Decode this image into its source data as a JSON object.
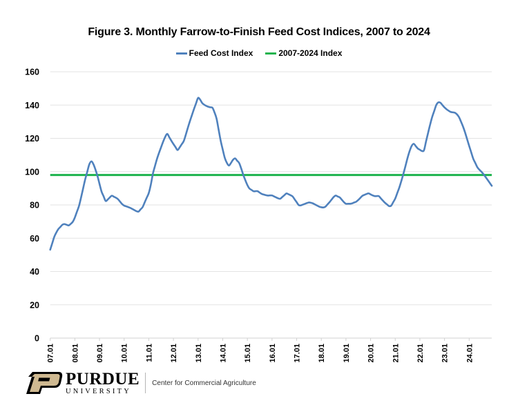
{
  "colors": {
    "feed_cost_line": "#4f81bd",
    "average_line": "#1db34d",
    "gridline": "#e3e3e3",
    "axis": "#d0d0d0",
    "purdue_gold": "#cfb991"
  },
  "footer": {
    "brand_top": "PURDUE",
    "brand_bottom": "UNIVERSITY",
    "center_name": "Center for Commercial Agriculture"
  },
  "chart_data": {
    "type": "line",
    "title": "Figure 3.  Monthly Farrow-to-Finish Feed Cost Indices, 2007 to 2024",
    "xlabel": "",
    "ylabel": "",
    "ylim": [
      0,
      160
    ],
    "yticks": [
      0,
      20,
      40,
      60,
      80,
      100,
      120,
      140,
      160
    ],
    "grid": true,
    "legend_position": "top-center",
    "x_start": "2007-01",
    "x_end": "2024-12",
    "x_frequency": "monthly",
    "xtick_labels": [
      "07.01",
      "08.01",
      "09.01",
      "10.01",
      "11.01",
      "12.01",
      "13.01",
      "14.01",
      "15.01",
      "16.01",
      "17.01",
      "18.01",
      "19.01",
      "20.01",
      "21.01",
      "22.01",
      "23.01",
      "24.01"
    ],
    "series": [
      {
        "name": "Feed Cost Index",
        "keypoints_month_index_value": [
          [
            0,
            53.1
          ],
          [
            2,
            60.9
          ],
          [
            3.6,
            65
          ],
          [
            6.4,
            68.7
          ],
          [
            9.2,
            67.6
          ],
          [
            11.4,
            70.4
          ],
          [
            14.2,
            80
          ],
          [
            17,
            95.2
          ],
          [
            19.3,
            105.6
          ],
          [
            20.4,
            106.5
          ],
          [
            22.6,
            99.4
          ],
          [
            24.9,
            88.3
          ],
          [
            27.1,
            82.1
          ],
          [
            29.9,
            85.6
          ],
          [
            32.7,
            83.9
          ],
          [
            35.5,
            79.8
          ],
          [
            38.9,
            78.3
          ],
          [
            42.8,
            75.7
          ],
          [
            45,
            78.7
          ],
          [
            48.4,
            88.3
          ],
          [
            50.1,
            99.4
          ],
          [
            52.3,
            109
          ],
          [
            55.2,
            118.7
          ],
          [
            56.8,
            123.1
          ],
          [
            59.6,
            117.3
          ],
          [
            62.1,
            112.8
          ],
          [
            65.2,
            118.7
          ],
          [
            67.5,
            128.4
          ],
          [
            70.3,
            138.7
          ],
          [
            72.2,
            144.9
          ],
          [
            74.2,
            140.8
          ],
          [
            76.5,
            139.1
          ],
          [
            79.2,
            138.3
          ],
          [
            80.9,
            132.5
          ],
          [
            83.2,
            117.3
          ],
          [
            85.4,
            106.3
          ],
          [
            87.1,
            103.5
          ],
          [
            89.7,
            108.4
          ],
          [
            92.2,
            104.9
          ],
          [
            94.4,
            96.6
          ],
          [
            96.6,
            90.2
          ],
          [
            99.4,
            87.9
          ],
          [
            100.6,
            88.6
          ],
          [
            102.8,
            86.7
          ],
          [
            105.6,
            85.6
          ],
          [
            107.8,
            85.8
          ],
          [
            111.8,
            83.5
          ],
          [
            115.1,
            87
          ],
          [
            117.9,
            85.3
          ],
          [
            121.3,
            79.4
          ],
          [
            125.8,
            81.5
          ],
          [
            127.5,
            81.2
          ],
          [
            131.4,
            78.7
          ],
          [
            133.6,
            78.4
          ],
          [
            135.9,
            81.5
          ],
          [
            138.7,
            85.8
          ],
          [
            141,
            84.5
          ],
          [
            143.7,
            80.7
          ],
          [
            146.5,
            80.7
          ],
          [
            149.3,
            82.1
          ],
          [
            152.1,
            85.6
          ],
          [
            154.9,
            87
          ],
          [
            157.7,
            85.3
          ],
          [
            160,
            85.3
          ],
          [
            162.8,
            81.5
          ],
          [
            165.6,
            78.7
          ],
          [
            167.9,
            83.5
          ],
          [
            170.3,
            91.5
          ],
          [
            172.3,
            100.1
          ],
          [
            174.6,
            111.1
          ],
          [
            176.6,
            117.3
          ],
          [
            179,
            113.9
          ],
          [
            181.8,
            111.8
          ],
          [
            183.5,
            120.8
          ],
          [
            185.7,
            131.8
          ],
          [
            188,
            140.1
          ],
          [
            189.4,
            142.2
          ],
          [
            192.4,
            138
          ],
          [
            194.8,
            135.9
          ],
          [
            197.5,
            135.3
          ],
          [
            199.2,
            132.5
          ],
          [
            201.5,
            125.6
          ],
          [
            203.7,
            116.6
          ],
          [
            206,
            107.7
          ],
          [
            208.2,
            102.1
          ],
          [
            210.4,
            99.4
          ],
          [
            212.1,
            96.6
          ],
          [
            215,
            91.5
          ]
        ]
      },
      {
        "name": "2007-2024 Index",
        "constant_value": 98
      }
    ]
  }
}
